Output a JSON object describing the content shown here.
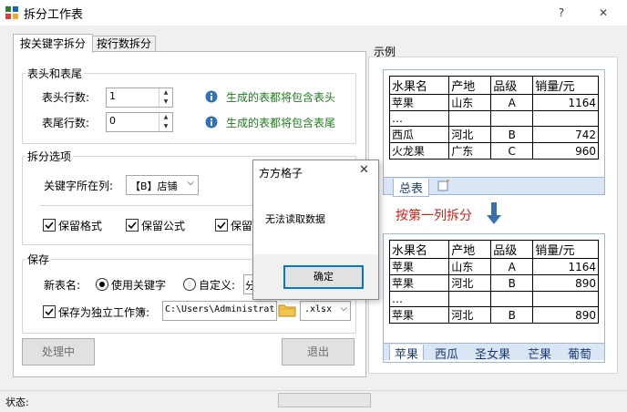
{
  "window": {
    "title": "拆分工作表",
    "help_glyph": "?",
    "close_glyph": "✕"
  },
  "tabs": [
    {
      "label": "按关键字拆分",
      "active": true
    },
    {
      "label": "按行数拆分",
      "active": false
    }
  ],
  "header_footer": {
    "group_title": "表头和表尾",
    "header_rows_label": "表头行数:",
    "header_rows_value": "1",
    "header_hint": "生成的表都将包含表头",
    "footer_rows_label": "表尾行数:",
    "footer_rows_value": "0",
    "footer_hint": "生成的表都将包含表尾"
  },
  "split_options": {
    "group_title": "拆分选项",
    "key_column_label": "关键字所在列:",
    "key_column_value": "【B】店铺",
    "keep_format_label": "保留格式",
    "keep_formula_label": "保留公式",
    "keep_third_label": "保留"
  },
  "save": {
    "group_title": "保存",
    "new_name_label": "新表名:",
    "use_keyword_label": "使用关键字",
    "custom_label": "自定义:",
    "custom_value": "分",
    "save_independent_label": "保存为独立工作簿:",
    "path_value": "C:\\Users\\Administrat",
    "ext_value": ".xlsx"
  },
  "buttons": {
    "process": "处理中",
    "exit": "退出"
  },
  "example": {
    "title": "示例",
    "top_table": {
      "headers": [
        "水果名",
        "产地",
        "品级",
        "销量/元"
      ],
      "rows": [
        [
          "苹果",
          "山东",
          "A",
          "1164"
        ],
        [
          "…",
          "",
          "",
          ""
        ],
        [
          "西瓜",
          "河北",
          "B",
          "742"
        ],
        [
          "火龙果",
          "广东",
          "C",
          "960"
        ]
      ],
      "sheet_tab": "总表"
    },
    "arrow_label": "按第一列拆分",
    "bottom_table": {
      "headers": [
        "水果名",
        "产地",
        "品级",
        "销量/元"
      ],
      "rows": [
        [
          "苹果",
          "山东",
          "A",
          "1164"
        ],
        [
          "苹果",
          "河北",
          "B",
          "890"
        ],
        [
          "…",
          "",
          "",
          ""
        ],
        [
          "苹果",
          "河北",
          "B",
          "890"
        ]
      ],
      "sheet_tabs": [
        "苹果",
        "西瓜",
        "圣女果",
        "芒果",
        "葡萄"
      ]
    }
  },
  "dialog": {
    "title": "方方格子",
    "message": "无法读取数据",
    "ok_label": "确定",
    "close_glyph": "✕"
  },
  "status": {
    "label": "状态:"
  },
  "colors": {
    "accent_blue": "#0078d7",
    "hint_green": "#1e7b1e",
    "arrow_label_red": "#d0201a",
    "sheet_tab_blue": "#dbe6f4",
    "arrow_blue": "#3a6fb0"
  }
}
